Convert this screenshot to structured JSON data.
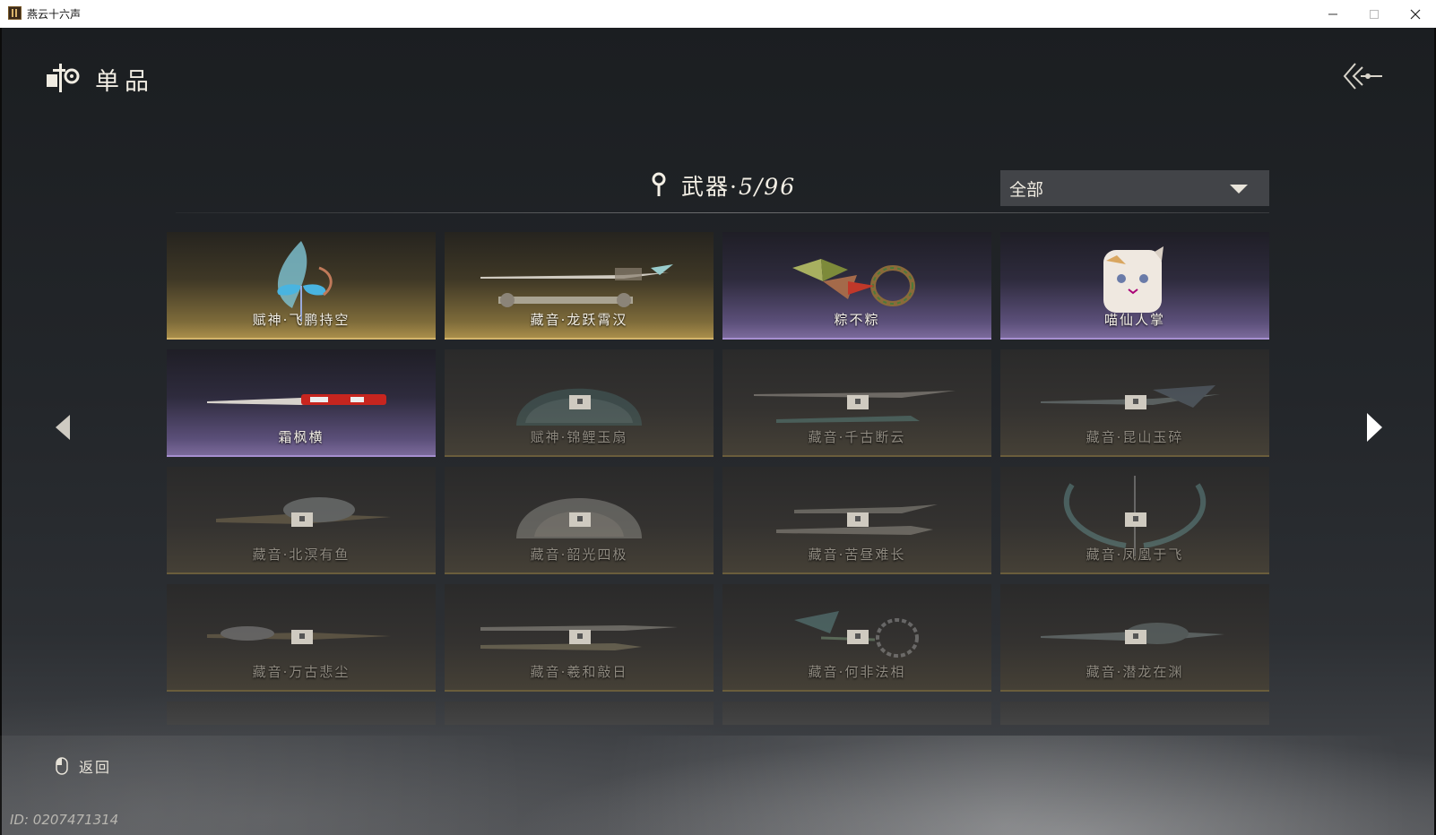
{
  "window": {
    "title": "燕云十六声"
  },
  "header": {
    "title": "单品"
  },
  "category": {
    "name": "武器",
    "separator": "·",
    "count": "5/96"
  },
  "filter": {
    "selected": "全部"
  },
  "items": [
    {
      "label": "赋神·飞鹏持空",
      "rarity": "gold",
      "locked": false
    },
    {
      "label": "藏音·龙跃霄汉",
      "rarity": "gold",
      "locked": false
    },
    {
      "label": "粽不粽",
      "rarity": "purple",
      "locked": false
    },
    {
      "label": "喵仙人掌",
      "rarity": "purple",
      "locked": false
    },
    {
      "label": "霜枫横",
      "rarity": "purple",
      "locked": false
    },
    {
      "label": "赋神·锦鲤玉扇",
      "rarity": "gold",
      "locked": true
    },
    {
      "label": "藏音·千古断云",
      "rarity": "gold",
      "locked": true
    },
    {
      "label": "藏音·昆山玉碎",
      "rarity": "gold",
      "locked": true
    },
    {
      "label": "藏音·北溟有鱼",
      "rarity": "gold",
      "locked": true
    },
    {
      "label": "藏音·韶光四极",
      "rarity": "gold",
      "locked": true
    },
    {
      "label": "藏音·苦昼难长",
      "rarity": "gold",
      "locked": true
    },
    {
      "label": "藏音·凤凰于飞",
      "rarity": "gold",
      "locked": true
    },
    {
      "label": "藏音·万古悲尘",
      "rarity": "gold",
      "locked": true
    },
    {
      "label": "藏音·羲和敲日",
      "rarity": "gold",
      "locked": true
    },
    {
      "label": "藏音·何非法相",
      "rarity": "gold",
      "locked": true
    },
    {
      "label": "藏音·潜龙在渊",
      "rarity": "gold",
      "locked": true
    }
  ],
  "hint": {
    "label": "返回"
  },
  "uid": "ID: 0207471314",
  "colors": {
    "gold_edge": "#d3b46a",
    "purple_edge": "#a68fd0"
  },
  "icons": {
    "header": "collection-icon",
    "back": "back-arrow-icon",
    "pin": "location-pin-icon",
    "lock": "lock-icon",
    "mouse": "mouse-icon"
  }
}
